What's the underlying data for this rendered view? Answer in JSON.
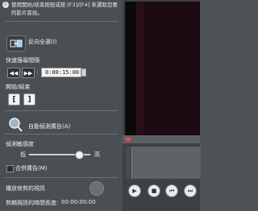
{
  "instructions": "使用開始/結束按鈕或按 [F3]/[F4] 來選取您要的影片區段。",
  "reverse": {
    "label": "反向全選(I)"
  },
  "speed_section": {
    "label": "快速搜尋間隔",
    "time_value": "0:00:15:00"
  },
  "startend_section": {
    "label": "開始/結束"
  },
  "auto_detect": {
    "label": "自動偵測廣告(A)"
  },
  "sensitivity": {
    "label": "偵測敏感度",
    "low": "低",
    "high": "高",
    "level": 0.82
  },
  "merge": {
    "label": "合併廣告(M)"
  },
  "playback": {
    "label": "播放修剪的視訊"
  },
  "duration": {
    "label": "剪輯視訊的時間長度:",
    "value": "00:00:00:00"
  },
  "colors": {
    "panel": "#4a4f53",
    "preview_bg": "#1c0a12",
    "playhead": "#e84a4a"
  },
  "icons": {
    "reverse": "reverse-select-icon",
    "rewind": "rewind-icon",
    "forward": "fast-forward-icon",
    "mark_start": "mark-start-icon",
    "mark_end": "mark-end-icon",
    "auto_detect": "magnifier-icon",
    "play": "play-icon",
    "stop": "stop-icon",
    "prev": "previous-icon",
    "next": "next-icon"
  }
}
